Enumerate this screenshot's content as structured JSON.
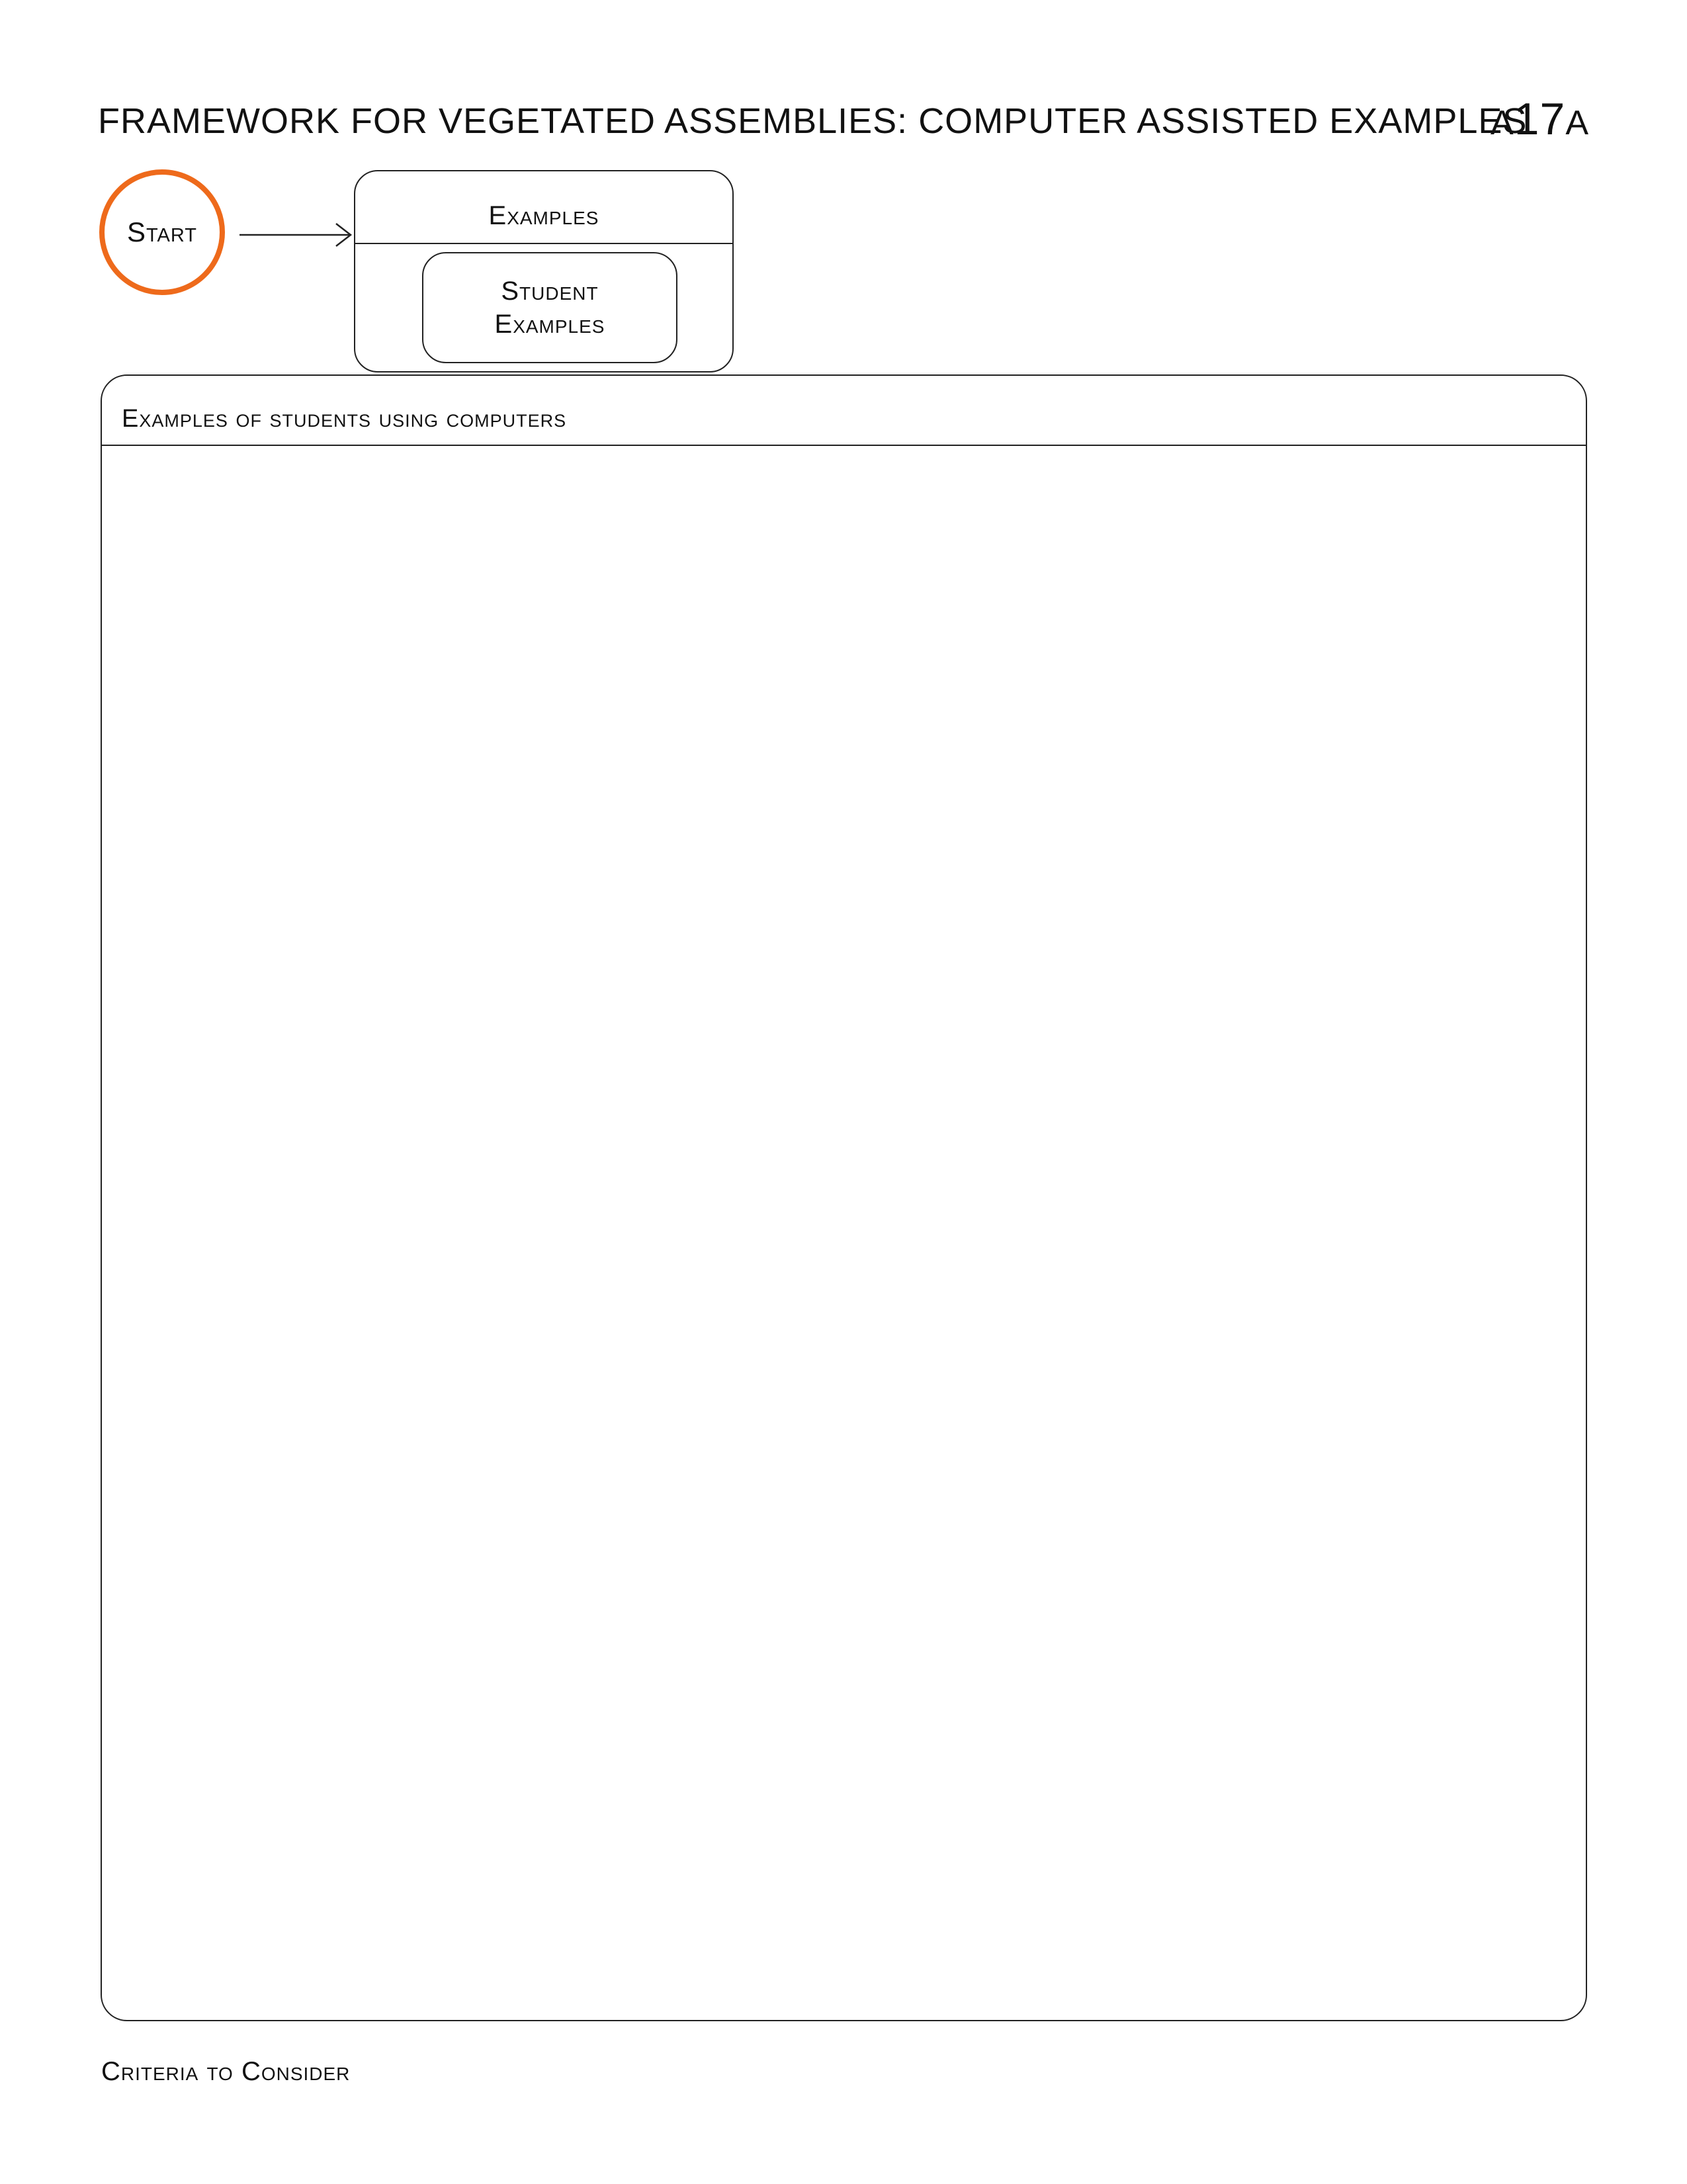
{
  "header": {
    "title": "FRAMEWORK FOR VEGETATED ASSEMBLIES: COMPUTER ASSISTED EXAMPLES",
    "code_prefix": "A",
    "code_number": "17",
    "code_suffix": "A"
  },
  "diagram": {
    "start_label": "Start",
    "examples_label": "Examples",
    "student_examples_line1": "Student",
    "student_examples_line2": "Examples"
  },
  "panel": {
    "title": "Examples of students using computers"
  },
  "footer": {
    "criteria_label": "Criteria to Consider"
  },
  "colors": {
    "start_ring": "#ee6a1b",
    "line": "#222222"
  }
}
